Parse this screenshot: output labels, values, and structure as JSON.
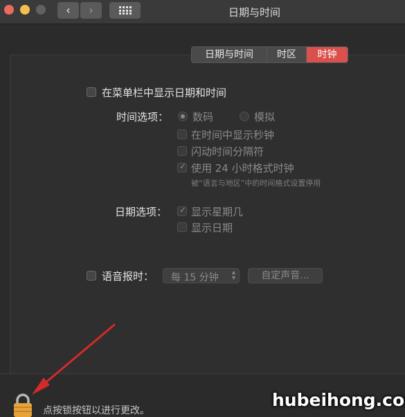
{
  "window": {
    "title": "日期与时间",
    "back_icon": "‹",
    "forward_icon": "›",
    "grid_icon": "grid-icon"
  },
  "tabs": [
    {
      "label": "日期与时间",
      "active": false
    },
    {
      "label": "时区",
      "active": false
    },
    {
      "label": "时钟",
      "active": true
    }
  ],
  "menubar_option": {
    "label": "在菜单栏中显示日期和时间",
    "checked": false
  },
  "time_options": {
    "heading": "时间选项：",
    "digital": "数码",
    "analog": "模拟",
    "show_seconds": "在时间中显示秒钟",
    "flash_separators": "闪动时间分隔符",
    "use_24h": "使用 24 小时格式时钟",
    "use_24h_note": "被“语言与地区”中的时间格式设置停用"
  },
  "date_options": {
    "heading": "日期选项：",
    "show_weekday": "显示星期几",
    "show_date": "显示日期"
  },
  "announce": {
    "label": "语音报时：",
    "interval": "每 15 分钟",
    "custom_voice": "自定声音..."
  },
  "footer": {
    "lock_text": "点按锁按钮以进行更改。"
  },
  "watermark": "hubeihong.com",
  "colors": {
    "accent": "#d9504c",
    "lock": "#e6a43a",
    "arrow": "#d42a2a"
  }
}
